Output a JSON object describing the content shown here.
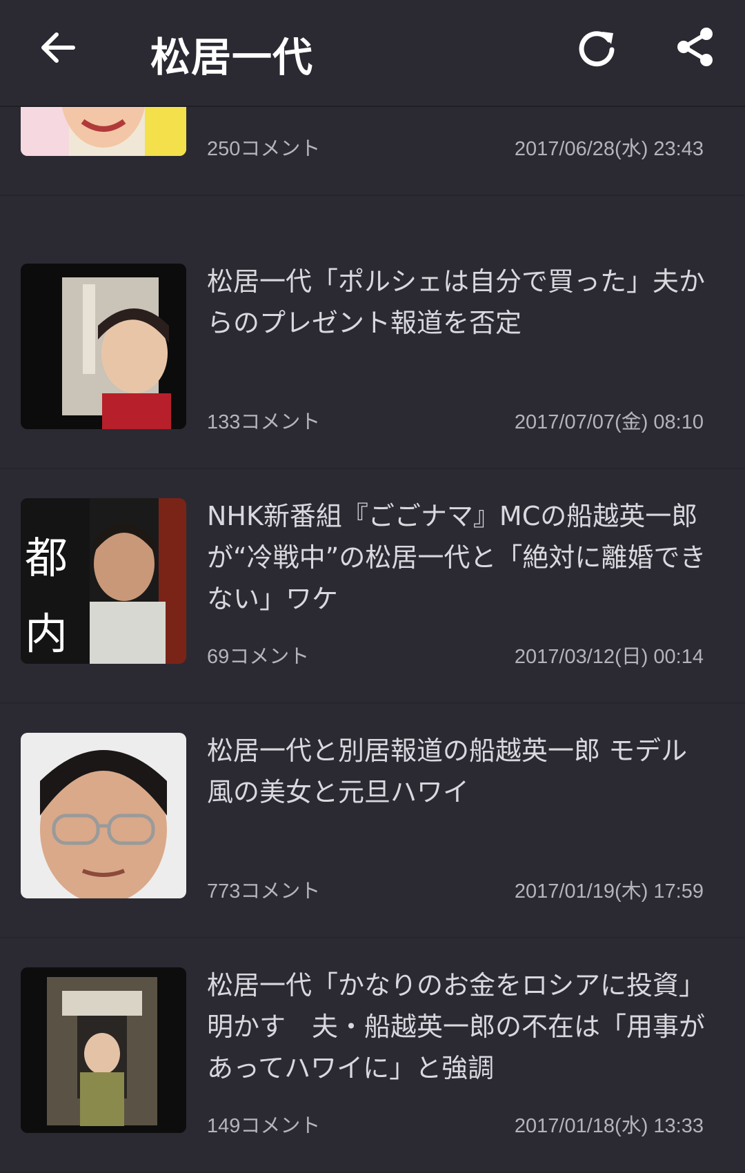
{
  "header": {
    "title": "松居一代",
    "back_icon": "arrow-left-icon",
    "refresh_icon": "refresh-icon",
    "share_icon": "share-icon"
  },
  "colors": {
    "background": "#2b2a33",
    "text": "#d9d8de",
    "meta": "#b5b4bb",
    "title": "#ffffff"
  },
  "items": [
    {
      "headline": "",
      "comments": "250コメント",
      "date": "2017/06/28(水) 23:43"
    },
    {
      "headline": "松居一代「ポルシェは自分で買った」夫からのプレゼント報道を否定",
      "comments": "133コメント",
      "date": "2017/07/07(金) 08:10"
    },
    {
      "headline": "NHK新番組『ごごナマ』MCの船越英一郎が“冷戦中”の松居一代と「絶対に離婚できない」ワケ",
      "comments": "69コメント",
      "date": "2017/03/12(日) 00:14"
    },
    {
      "headline": "松居一代と別居報道の船越英一郎 モデル風の美女と元旦ハワイ",
      "comments": "773コメント",
      "date": "2017/01/19(木) 17:59"
    },
    {
      "headline": "松居一代「かなりのお金をロシアに投資」明かす　夫・船越英一郎の不在は「用事があってハワイに」と強調",
      "comments": "149コメント",
      "date": "2017/01/18(水) 13:33"
    }
  ]
}
